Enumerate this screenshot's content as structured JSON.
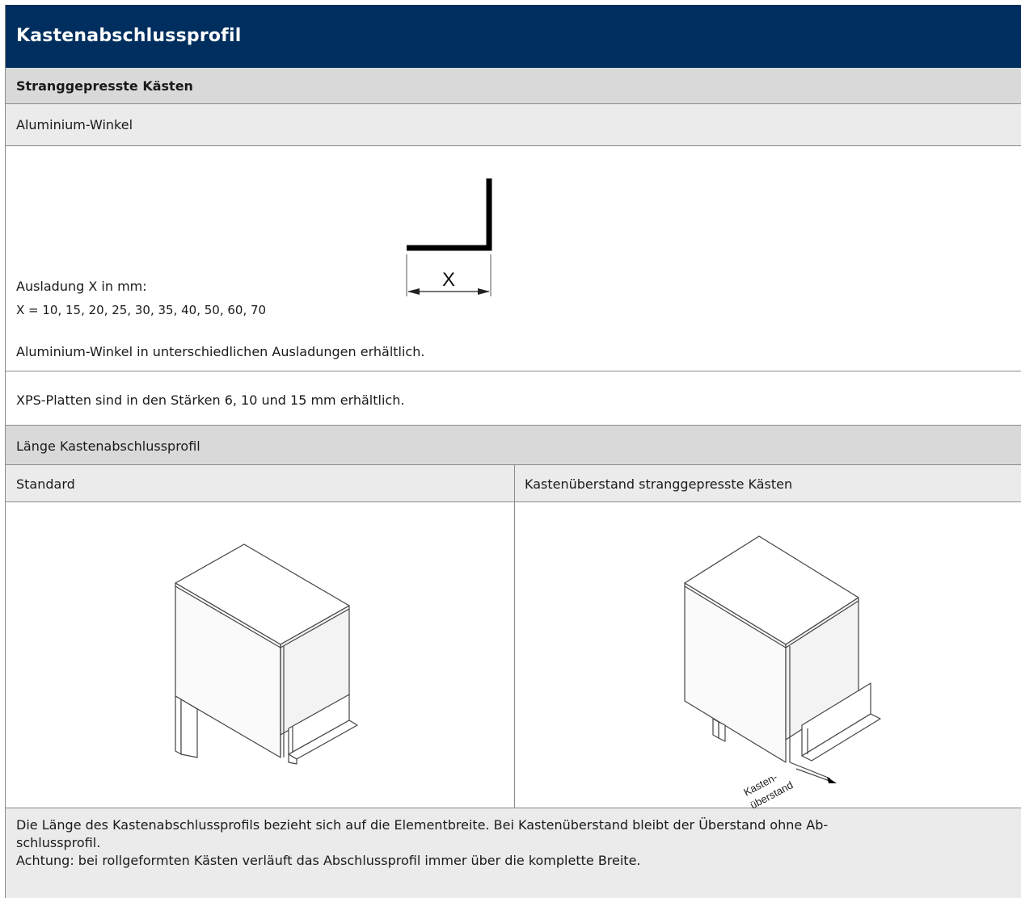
{
  "header": {
    "title": "Kastenabschlussprofil"
  },
  "subheader": {
    "title": "Stranggepresste Kästen"
  },
  "aluminium": {
    "section_title": "Aluminium-Winkel",
    "ausladung_label": "Ausladung X in mm:",
    "x_values": "X = 10, 15, 20, 25, 30, 35, 40, 50, 60, 70",
    "diagram_label": "X",
    "note": "Aluminium-Winkel in unterschiedlichen Ausladungen erhältlich."
  },
  "xps": {
    "note": "XPS-Platten sind in den Stärken 6, 10 und 15 mm erhältlich."
  },
  "length": {
    "section_title": "Länge Kastenabschlussprofil",
    "col_standard": "Standard",
    "col_overhang": "Kastenüberstand stranggepresste Kästen",
    "overhang_label_1": "Kasten-",
    "overhang_label_2": "überstand"
  },
  "footer": {
    "line1": "Die Länge des Kastenabschlussprofils bezieht sich auf die Elementbreite. Bei Kastenüberstand bleibt der Überstand ohne Ab-",
    "line2": "schlussprofil.",
    "line3": "Achtung: bei rollgeformten Kästen verläuft das Abschlussprofil immer über die komplette Breite."
  },
  "colors": {
    "header_bg": "#002f5f",
    "subheader_bg": "#d9d9d9",
    "row_bg": "#ebebeb",
    "border": "#8a8a8a"
  }
}
